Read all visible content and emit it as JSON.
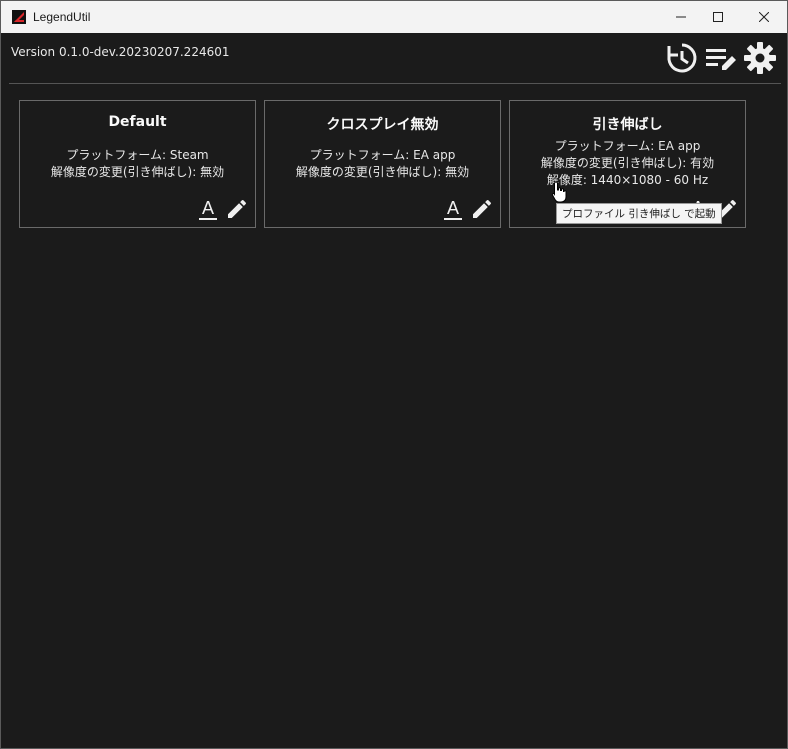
{
  "window": {
    "title": "LegendUtil"
  },
  "header": {
    "version": "Version 0.1.0-dev.20230207.224601",
    "icons": [
      "history-icon",
      "edit-list-icon",
      "settings-icon"
    ]
  },
  "profiles": [
    {
      "name": "Default",
      "lines": [
        "プラットフォーム: Steam",
        "解像度の変更(引き伸ばし): 無効"
      ]
    },
    {
      "name": "クロスプレイ無効",
      "lines": [
        "プラットフォーム: EA app",
        "解像度の変更(引き伸ばし): 無効"
      ]
    },
    {
      "name": "引き伸ばし",
      "lines": [
        "プラットフォーム: EA app",
        "解像度の変更(引き伸ばし): 有効",
        "解像度: 1440×1080 - 60 Hz"
      ]
    }
  ],
  "tooltip": "プロファイル 引き伸ばし で起動",
  "colors": {
    "background": "#1b1b1b",
    "titlebar": "#f3f3f3",
    "text": "#e8e8e8",
    "border": "#6a6a6a"
  }
}
